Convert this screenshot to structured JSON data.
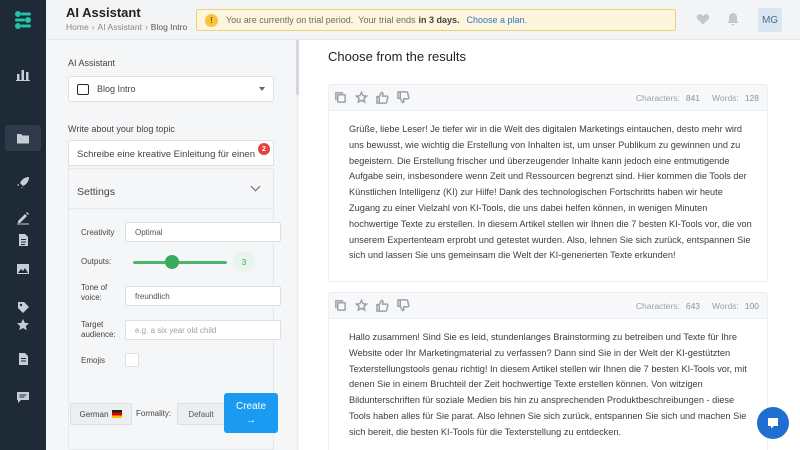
{
  "header": {
    "app_title": "AI Assistant",
    "breadcrumb": [
      "Home",
      "AI Assistant",
      "Blog Intro"
    ],
    "trial": {
      "text_before": "You are currently on trial period.",
      "text_mid": "Your trial ends",
      "text_bold": "in 3 days.",
      "link": "Choose a plan."
    },
    "avatar_initials": "MG",
    "icons": [
      "heart-icon",
      "bell-icon"
    ]
  },
  "sidebar": {
    "icons": [
      "logo-icon",
      "chart-icon",
      "folder-icon",
      "rocket-icon",
      "pen-icon",
      "document-icon",
      "image-icon",
      "tag-icon",
      "star-icon",
      "notes-icon",
      "chat-icon"
    ]
  },
  "left": {
    "assistant_label": "AI Assistant",
    "template_select": "Blog Intro",
    "topic_label": "Write about your blog topic",
    "topic_value": "Schreibe eine kreative Einleitung für einen",
    "topic_badge": "2",
    "settings": {
      "title": "Settings",
      "creativity_label": "Creativity",
      "creativity_value": "Optimal",
      "outputs_label": "Outputs:",
      "outputs_value": "3",
      "tone_label": "Tone of voice:",
      "tone_value": "freundlich",
      "target_label": "Target audience:",
      "target_placeholder": "e.g. a six year old child",
      "emojis_label": "Emojis",
      "emojis_checked": false
    },
    "language": "German",
    "formality_label": "Formality:",
    "formality_value": "Default",
    "create_label": "Create",
    "create_arrow": "→"
  },
  "results": {
    "title": "Choose from the results",
    "cards": [
      {
        "characters_label": "Characters:",
        "characters": "841",
        "words_label": "Words:",
        "words": "128",
        "text": "Grüße, liebe Leser! Je tiefer wir in die Welt des digitalen Marketings eintauchen, desto mehr wird uns bewusst, wie wichtig die Erstellung von Inhalten ist, um unser Publikum zu gewinnen und zu begeistern. Die Erstellung frischer und überzeugender Inhalte kann jedoch eine entmutigende Aufgabe sein, insbesondere wenn Zeit und Ressourcen begrenzt sind. Hier kommen die Tools der Künstlichen Intelligenz (KI) zur Hilfe! Dank des technologischen Fortschritts haben wir heute Zugang zu einer Vielzahl von KI-Tools, die uns dabei helfen können, in wenigen Minuten hochwertige Texte zu erstellen. In diesem Artikel stellen wir Ihnen die 7 besten KI-Tools vor, die von unserem Expertenteam erprobt und getestet wurden. Also, lehnen Sie sich zurück, entspannen Sie sich und lassen Sie uns gemeinsam die Welt der KI-generierten Texte erkunden!"
      },
      {
        "characters_label": "Characters:",
        "characters": "643",
        "words_label": "Words:",
        "words": "100",
        "text": "Hallo zusammen! Sind Sie es leid, stundenlanges Brainstorming zu betreiben und Texte für Ihre Website oder Ihr Marketingmaterial zu verfassen? Dann sind Sie in der Welt der KI-gestützten Texterstellungstools genau richtig! In diesem Artikel stellen wir Ihnen die 7 besten KI-Tools vor, mit denen Sie in einem Bruchteil der Zeit hochwertige Texte erstellen können. Von witzigen Bildunterschriften für soziale Medien bis hin zu ansprechenden Produktbeschreibungen - diese Tools haben alles für Sie parat. Also lehnen Sie sich zurück, entspannen Sie sich und machen Sie sich bereit, die besten KI-Tools für die Texterstellung zu entdecken."
      }
    ]
  },
  "colors": {
    "sidebar": "#1f2a37",
    "accent": "#1a9af0",
    "slider": "#3aaa5c",
    "banner_bg": "#fdf6dc"
  }
}
